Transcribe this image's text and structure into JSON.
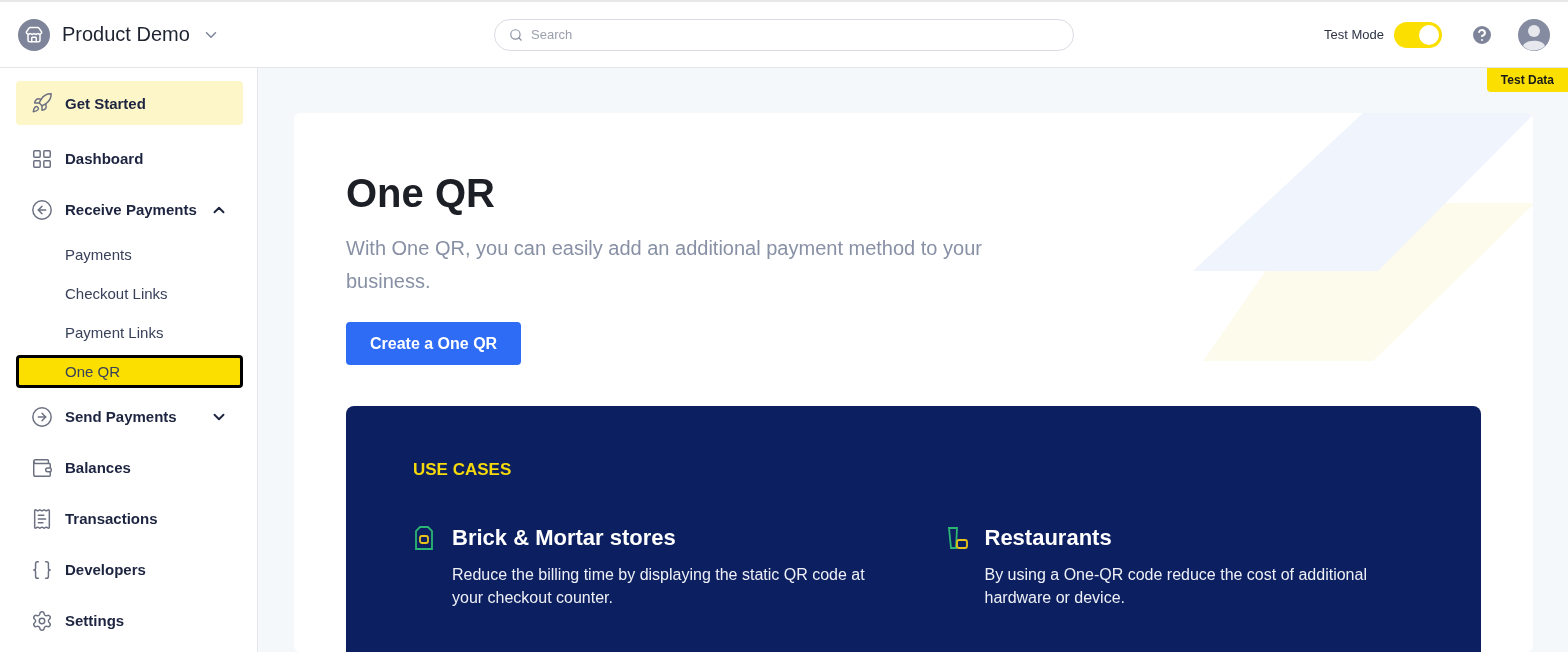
{
  "header": {
    "workspace": "Product Demo",
    "search": {
      "placeholder": "Search"
    },
    "test_mode": {
      "label": "Test Mode",
      "on": true
    }
  },
  "badge": "Test Data",
  "sidebar": {
    "items": [
      {
        "label": "Get Started",
        "kind": "featured",
        "selected": false
      },
      {
        "label": "Dashboard",
        "kind": "link",
        "selected": false
      },
      {
        "label": "Receive Payments",
        "kind": "group",
        "selected": false,
        "expanded": true,
        "children": [
          {
            "label": "Payments",
            "selected": false
          },
          {
            "label": "Checkout Links",
            "selected": false
          },
          {
            "label": "Payment Links",
            "selected": false
          },
          {
            "label": "One QR",
            "selected": true
          }
        ]
      },
      {
        "label": "Send Payments",
        "kind": "group",
        "selected": false,
        "expanded": false
      },
      {
        "label": "Balances",
        "kind": "link",
        "selected": false
      },
      {
        "label": "Transactions",
        "kind": "link",
        "selected": false
      },
      {
        "label": "Developers",
        "kind": "link",
        "selected": false
      },
      {
        "label": "Settings",
        "kind": "link",
        "selected": false
      }
    ]
  },
  "hero": {
    "title": "One QR",
    "description": "With One QR, you can easily add an additional payment method to your business.",
    "button": "Create a One QR"
  },
  "use_cases": {
    "heading": "USE CASES",
    "cases": [
      {
        "title": "Brick & Mortar stores",
        "text": "Reduce the billing time by displaying the static QR code at your checkout counter."
      },
      {
        "title": "Restaurants",
        "text": "By using a One-QR code reduce the cost of additional hardware or device."
      }
    ]
  }
}
